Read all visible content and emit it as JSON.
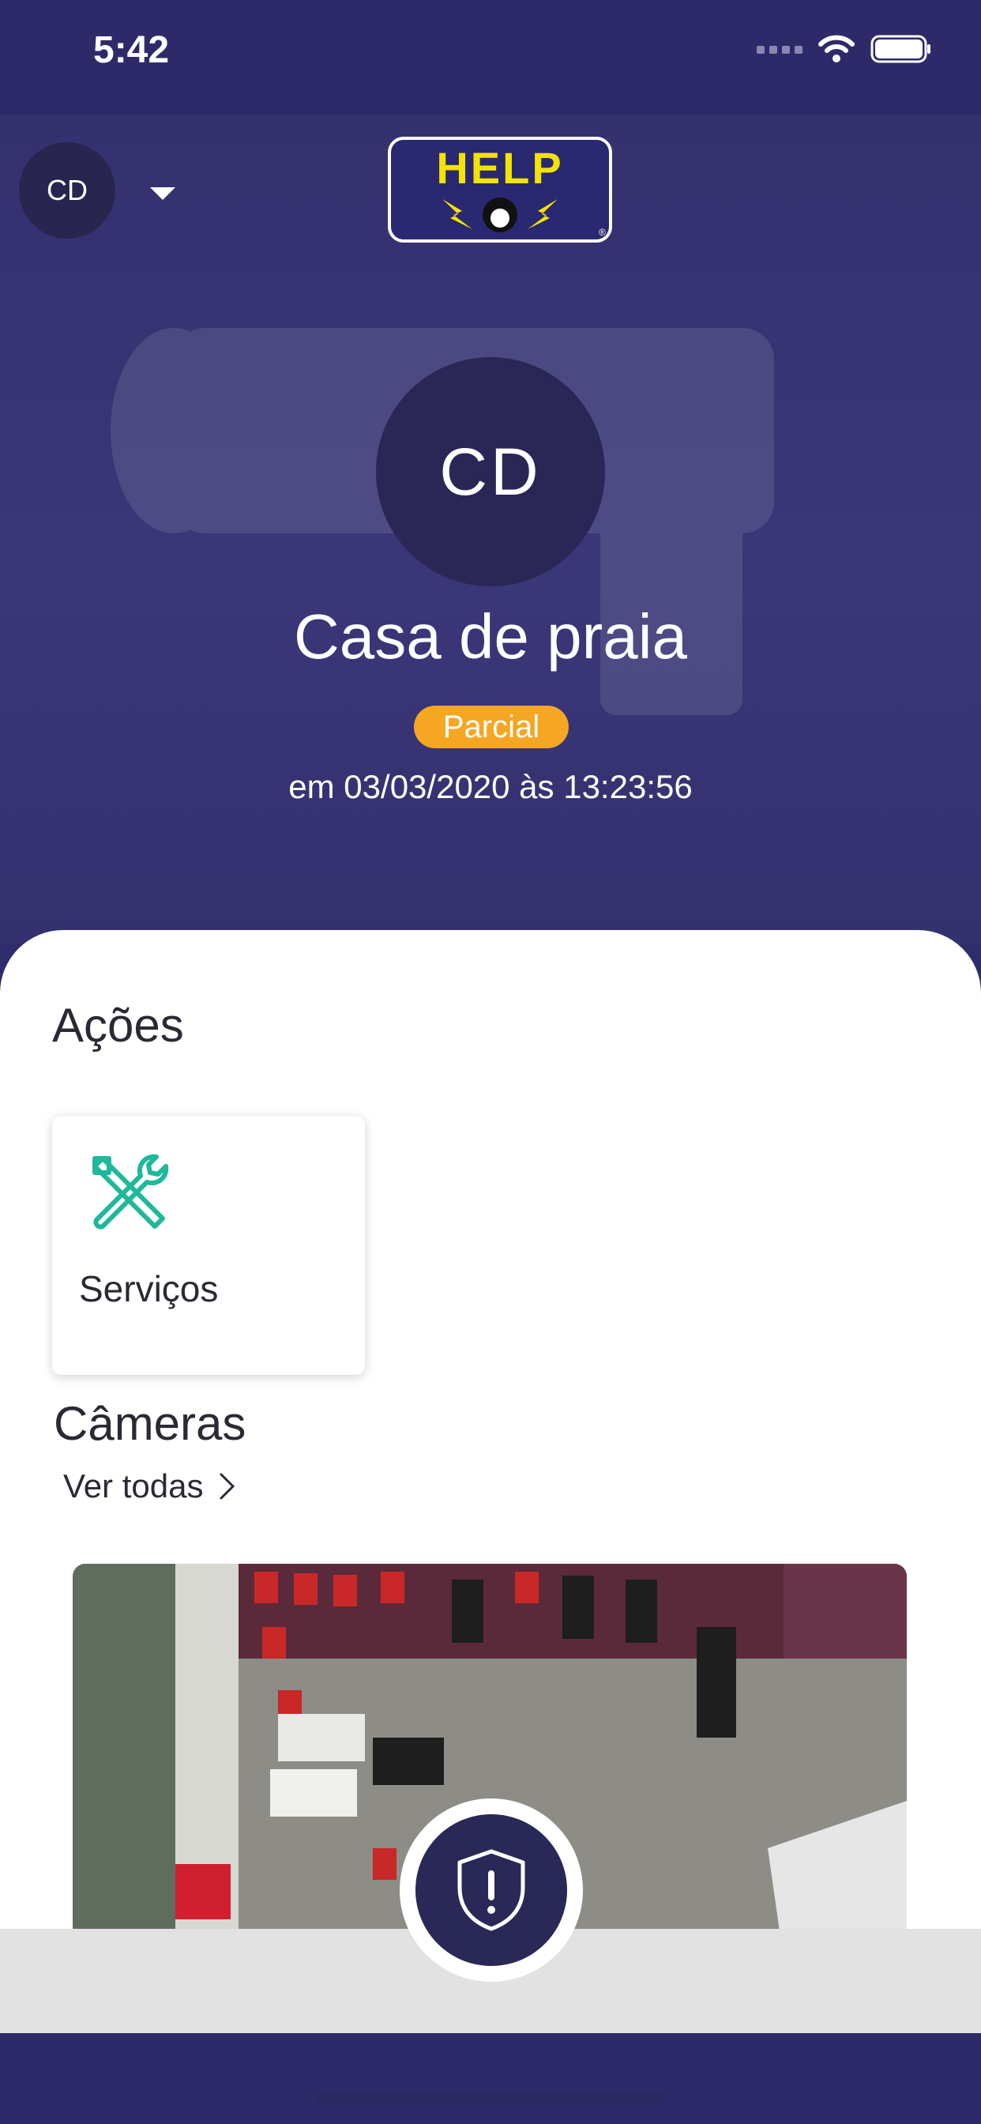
{
  "status_bar": {
    "time": "5:42"
  },
  "header": {
    "account_initials": "CD",
    "logo_text": "HELP"
  },
  "profile": {
    "initials": "CD",
    "name": "Casa de praia",
    "status": "Parcial",
    "status_color": "#f5a623",
    "updated": "em 03/03/2020 às 13:23:56"
  },
  "actions": {
    "title": "Ações",
    "items": [
      {
        "label": "Serviços",
        "icon": "tools-icon",
        "icon_color": "#1fb89a"
      }
    ]
  },
  "cameras": {
    "title": "Câmeras",
    "see_all": "Ver todas"
  },
  "colors": {
    "brand": "#2e2a6a",
    "accent": "#f5a623",
    "logo_yellow": "#f2e400"
  }
}
